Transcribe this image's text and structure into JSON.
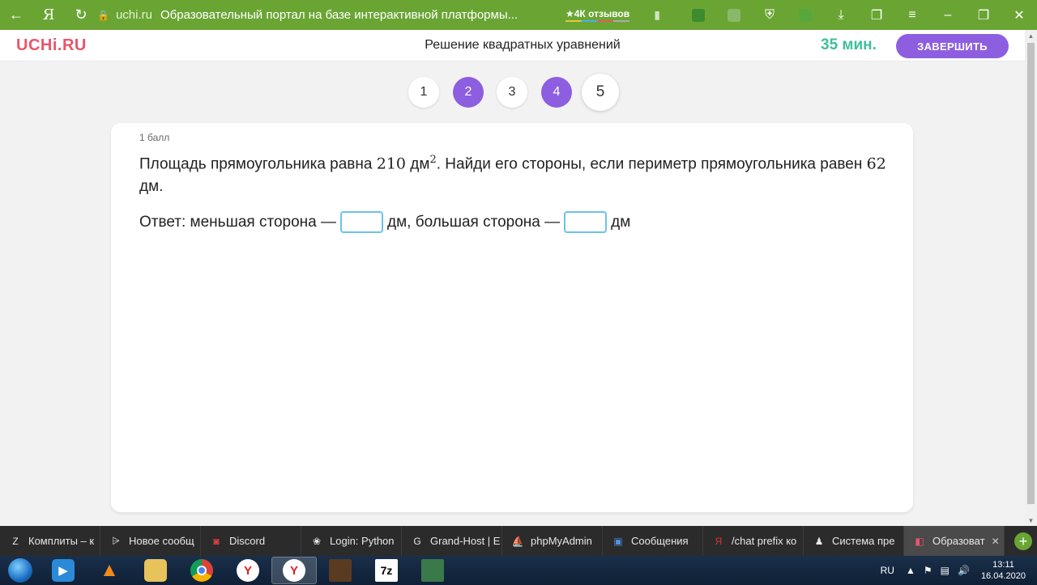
{
  "browser": {
    "domain": "uchi.ru",
    "title": "Образовательный портал на базе интерактивной платформы...",
    "reviews": "★4К отзывов",
    "icons": [
      "back-arrow-icon",
      "yandex-icon",
      "reload-icon",
      "lock-icon",
      "bookmark-icon",
      "download-icon",
      "menu-icon",
      "minimize-icon",
      "restore-icon",
      "close-icon"
    ]
  },
  "header": {
    "logo": "UCHi.RU",
    "lesson_title": "Решение квадратных уравнений",
    "timer": "35 мин.",
    "finish_label": "ЗАВЕРШИТЬ"
  },
  "steps": [
    {
      "label": "1",
      "state": "open"
    },
    {
      "label": "2",
      "state": "done"
    },
    {
      "label": "3",
      "state": "open"
    },
    {
      "label": "4",
      "state": "done"
    },
    {
      "label": "5",
      "state": "current"
    }
  ],
  "task": {
    "points": "1 балл",
    "q_part1": "Площадь прямоугольника равна ",
    "q_math1": "210",
    "q_unit1": " дм",
    "q_sup": "2",
    "q_part2": ". Найди его стороны, если периметр прямоугольника равен ",
    "q_math2": "62",
    "q_part3": " дм.",
    "answer_prefix": "Ответ: меньшая сторона —",
    "answer_mid": "дм, большая сторона —",
    "answer_suffix": "дм",
    "input1_value": "",
    "input2_value": ""
  },
  "tabs": [
    {
      "label": "Комплиты – к",
      "icon": "Z"
    },
    {
      "label": "Новое сообщ",
      "icon": "⩥"
    },
    {
      "label": "Discord",
      "icon": "◙"
    },
    {
      "label": "Login: Python",
      "icon": "❀"
    },
    {
      "label": "Grand-Host | E",
      "icon": "G"
    },
    {
      "label": "phpMyAdmin",
      "icon": "⛵"
    },
    {
      "label": "Сообщения",
      "icon": "▣"
    },
    {
      "label": "/chat prefix ко",
      "icon": "Я"
    },
    {
      "label": "Система пре",
      "icon": "♟"
    },
    {
      "label": "Образоват",
      "icon": "◧"
    }
  ],
  "taskbar": {
    "apps": [
      "media-player",
      "vlc",
      "folder",
      "chrome",
      "yandex-browser",
      "yandex-browser-active",
      "game",
      "7zip",
      "remote-desktop"
    ],
    "lang": "RU",
    "time": "13:11",
    "date": "16.04.2020"
  }
}
